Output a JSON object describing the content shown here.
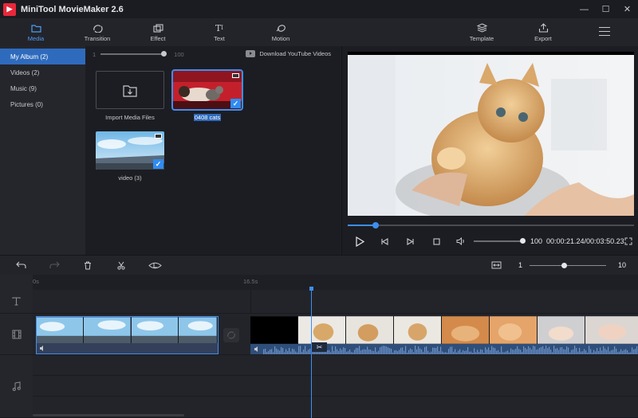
{
  "window": {
    "title": "MiniTool MovieMaker 2.6",
    "controls": [
      "—",
      "☐",
      "✕"
    ]
  },
  "toolbar": {
    "tabs": [
      {
        "label": "Media",
        "icon": "folder-icon",
        "active": true
      },
      {
        "label": "Transition",
        "icon": "transition-icon"
      },
      {
        "label": "Effect",
        "icon": "effect-icon"
      },
      {
        "label": "Text",
        "icon": "text-icon"
      },
      {
        "label": "Motion",
        "icon": "motion-icon"
      }
    ],
    "right": [
      {
        "label": "Template",
        "icon": "template-icon"
      },
      {
        "label": "Export",
        "icon": "export-icon"
      }
    ],
    "menu_icon": "hamburger-menu-icon"
  },
  "sidebar": {
    "items": [
      {
        "label": "My Album",
        "count": "(2)",
        "active": true
      },
      {
        "label": "Videos",
        "count": "(2)"
      },
      {
        "label": "Music",
        "count": "(9)"
      },
      {
        "label": "Pictures",
        "count": "(0)"
      }
    ]
  },
  "library": {
    "zoom_min": "1",
    "zoom_max": "100",
    "download_label": "Download YouTube Videos",
    "tiles": [
      {
        "label": "Import Media Files",
        "kind": "import"
      },
      {
        "label": "0408 cats",
        "kind": "video",
        "selected": true
      },
      {
        "label": "video (3)",
        "kind": "video",
        "selected": false
      }
    ]
  },
  "preview": {
    "progress": 0.098,
    "volume": "100",
    "volume_level": 1.0,
    "timecode": "00:00:21.24/00:03:50.23"
  },
  "timeline": {
    "zoom_min": "1",
    "zoom_max": "10",
    "zoom_level": 0.45,
    "ruler": [
      "0s",
      "16.5s"
    ],
    "colors": {
      "accent": "#3e8ef0",
      "selection": "#2f6bbd"
    }
  }
}
